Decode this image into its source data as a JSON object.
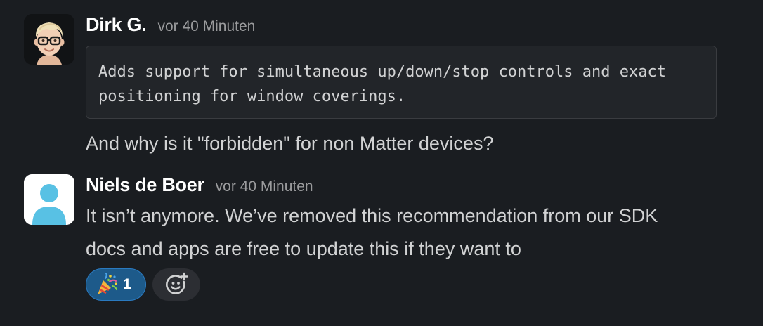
{
  "messages": [
    {
      "author": "Dirk G.",
      "timestamp": "vor 40 Minuten",
      "avatar_icon": "memoji-avatar-icon",
      "code_block": "Adds support for simultaneous up/down/stop controls and exact\npositioning for window coverings.",
      "text": "And why is it \"forbidden\" for non Matter devices?"
    },
    {
      "author": "Niels de Boer",
      "timestamp": "vor 40 Minuten",
      "avatar_icon": "default-user-avatar-icon",
      "text_lines": [
        "It isn’t anymore. We’ve removed this recommendation from our SDK",
        "docs and apps are free to update this if they want to"
      ],
      "reactions": [
        {
          "emoji": "party-popper-icon",
          "count": "1"
        }
      ],
      "add_reaction_icon": "add-emoji-icon"
    }
  ],
  "colors": {
    "background": "#1a1d21",
    "reaction_active": "#1d5a8a",
    "avatar_default": "#58c1e4"
  }
}
